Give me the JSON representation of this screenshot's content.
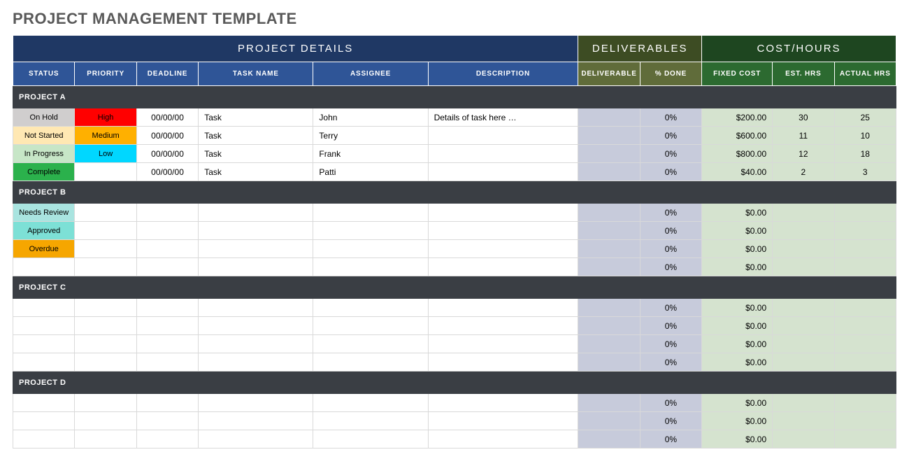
{
  "title": "PROJECT MANAGEMENT TEMPLATE",
  "topHeaders": {
    "details": "PROJECT DETAILS",
    "deliverables": "DELIVERABLES",
    "costhours": "COST/HOURS"
  },
  "columns": [
    "STATUS",
    "PRIORITY",
    "DEADLINE",
    "TASK NAME",
    "ASSIGNEE",
    "DESCRIPTION",
    "DELIVERABLE",
    "% DONE",
    "FIXED COST",
    "EST. HRS",
    "ACTUAL HRS"
  ],
  "projects": [
    {
      "name": "PROJECT A",
      "rows": [
        {
          "status": "On Hold",
          "statusColor": "onhold",
          "priority": "High",
          "priorityColor": "high",
          "deadline": "00/00/00",
          "task": "Task",
          "assignee": "John",
          "description": "Details of task here …",
          "deliverable": "",
          "done": "0%",
          "cost": "$200.00",
          "est": "30",
          "act": "25"
        },
        {
          "status": "Not Started",
          "statusColor": "notstarted",
          "priority": "Medium",
          "priorityColor": "medium",
          "deadline": "00/00/00",
          "task": "Task",
          "assignee": "Terry",
          "description": "",
          "deliverable": "",
          "done": "0%",
          "cost": "$600.00",
          "est": "11",
          "act": "10"
        },
        {
          "status": "In Progress",
          "statusColor": "inprogress",
          "priority": "Low",
          "priorityColor": "low",
          "deadline": "00/00/00",
          "task": "Task",
          "assignee": "Frank",
          "description": "",
          "deliverable": "",
          "done": "0%",
          "cost": "$800.00",
          "est": "12",
          "act": "18"
        },
        {
          "status": "Complete",
          "statusColor": "complete",
          "priority": "",
          "priorityColor": "",
          "deadline": "00/00/00",
          "task": "Task",
          "assignee": "Patti",
          "description": "",
          "deliverable": "",
          "done": "0%",
          "cost": "$40.00",
          "est": "2",
          "act": "3"
        }
      ]
    },
    {
      "name": "PROJECT B",
      "rows": [
        {
          "status": "Needs Review",
          "statusColor": "needsreview",
          "priority": "",
          "priorityColor": "",
          "deadline": "",
          "task": "",
          "assignee": "",
          "description": "",
          "deliverable": "",
          "done": "0%",
          "cost": "$0.00",
          "est": "",
          "act": ""
        },
        {
          "status": "Approved",
          "statusColor": "approved",
          "priority": "",
          "priorityColor": "",
          "deadline": "",
          "task": "",
          "assignee": "",
          "description": "",
          "deliverable": "",
          "done": "0%",
          "cost": "$0.00",
          "est": "",
          "act": ""
        },
        {
          "status": "Overdue",
          "statusColor": "overdue",
          "priority": "",
          "priorityColor": "",
          "deadline": "",
          "task": "",
          "assignee": "",
          "description": "",
          "deliverable": "",
          "done": "0%",
          "cost": "$0.00",
          "est": "",
          "act": ""
        },
        {
          "status": "",
          "statusColor": "",
          "priority": "",
          "priorityColor": "",
          "deadline": "",
          "task": "",
          "assignee": "",
          "description": "",
          "deliverable": "",
          "done": "0%",
          "cost": "$0.00",
          "est": "",
          "act": ""
        }
      ]
    },
    {
      "name": "PROJECT C",
      "rows": [
        {
          "status": "",
          "statusColor": "",
          "priority": "",
          "priorityColor": "",
          "deadline": "",
          "task": "",
          "assignee": "",
          "description": "",
          "deliverable": "",
          "done": "0%",
          "cost": "$0.00",
          "est": "",
          "act": ""
        },
        {
          "status": "",
          "statusColor": "",
          "priority": "",
          "priorityColor": "",
          "deadline": "",
          "task": "",
          "assignee": "",
          "description": "",
          "deliverable": "",
          "done": "0%",
          "cost": "$0.00",
          "est": "",
          "act": ""
        },
        {
          "status": "",
          "statusColor": "",
          "priority": "",
          "priorityColor": "",
          "deadline": "",
          "task": "",
          "assignee": "",
          "description": "",
          "deliverable": "",
          "done": "0%",
          "cost": "$0.00",
          "est": "",
          "act": ""
        },
        {
          "status": "",
          "statusColor": "",
          "priority": "",
          "priorityColor": "",
          "deadline": "",
          "task": "",
          "assignee": "",
          "description": "",
          "deliverable": "",
          "done": "0%",
          "cost": "$0.00",
          "est": "",
          "act": ""
        }
      ]
    },
    {
      "name": "PROJECT D",
      "rows": [
        {
          "status": "",
          "statusColor": "",
          "priority": "",
          "priorityColor": "",
          "deadline": "",
          "task": "",
          "assignee": "",
          "description": "",
          "deliverable": "",
          "done": "0%",
          "cost": "$0.00",
          "est": "",
          "act": ""
        },
        {
          "status": "",
          "statusColor": "",
          "priority": "",
          "priorityColor": "",
          "deadline": "",
          "task": "",
          "assignee": "",
          "description": "",
          "deliverable": "",
          "done": "0%",
          "cost": "$0.00",
          "est": "",
          "act": ""
        },
        {
          "status": "",
          "statusColor": "",
          "priority": "",
          "priorityColor": "",
          "deadline": "",
          "task": "",
          "assignee": "",
          "description": "",
          "deliverable": "",
          "done": "0%",
          "cost": "$0.00",
          "est": "",
          "act": ""
        }
      ]
    }
  ]
}
